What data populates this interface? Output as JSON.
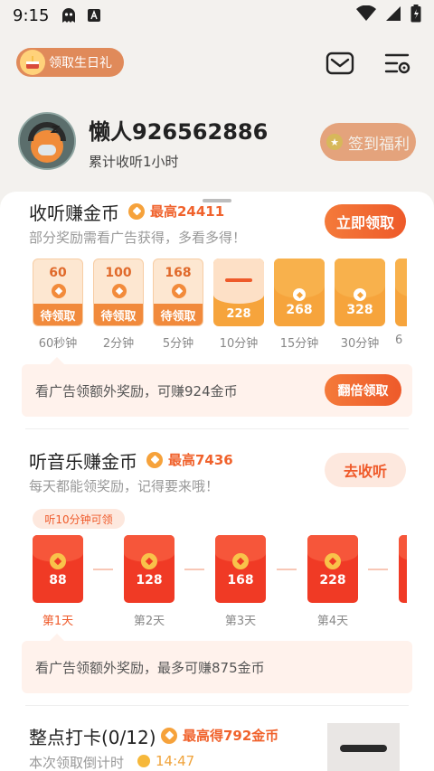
{
  "status_bar": {
    "time": "9:15"
  },
  "header": {
    "birthday_label": "领取生日礼",
    "user_name": "懒人926562886",
    "listen_time": "累计收听1小时",
    "signin_label": "签到福利"
  },
  "listen_section": {
    "title": "收听赚金币",
    "max_label": "最高24411",
    "subtitle": "部分奖励需看广告获得，多看多得！",
    "claim_button": "立即领取",
    "rewards": [
      {
        "amount": "60",
        "status": "待领取",
        "label": "60秒钟"
      },
      {
        "amount": "100",
        "status": "待领取",
        "label": "2分钟"
      },
      {
        "amount": "168",
        "status": "待领取",
        "label": "5分钟"
      },
      {
        "amount": "228",
        "status": "",
        "label": "10分钟"
      },
      {
        "amount": "268",
        "status": "",
        "label": "15分钟"
      },
      {
        "amount": "328",
        "status": "",
        "label": "30分钟"
      },
      {
        "amount": "",
        "status": "",
        "label": "6"
      }
    ],
    "tip_text": "看广告领额外奖励，可赚924金币",
    "tip_button": "翻倍领取"
  },
  "music_section": {
    "title": "听音乐赚金币",
    "max_label": "最高7436",
    "subtitle": "每天都能领奖励，记得要来哦！",
    "action_button": "去收听",
    "pill": "听10分钟可领",
    "days": [
      {
        "amount": "88",
        "label": "第1天"
      },
      {
        "amount": "128",
        "label": "第2天"
      },
      {
        "amount": "168",
        "label": "第3天"
      },
      {
        "amount": "228",
        "label": "第4天"
      }
    ],
    "tip_text": "看广告领额外奖励，最多可赚875金币"
  },
  "punch_section": {
    "title": "整点打卡(0/12)",
    "max_label": "最高得792金币",
    "subtitle": "本次领取倒计时",
    "countdown": "14:47"
  }
}
